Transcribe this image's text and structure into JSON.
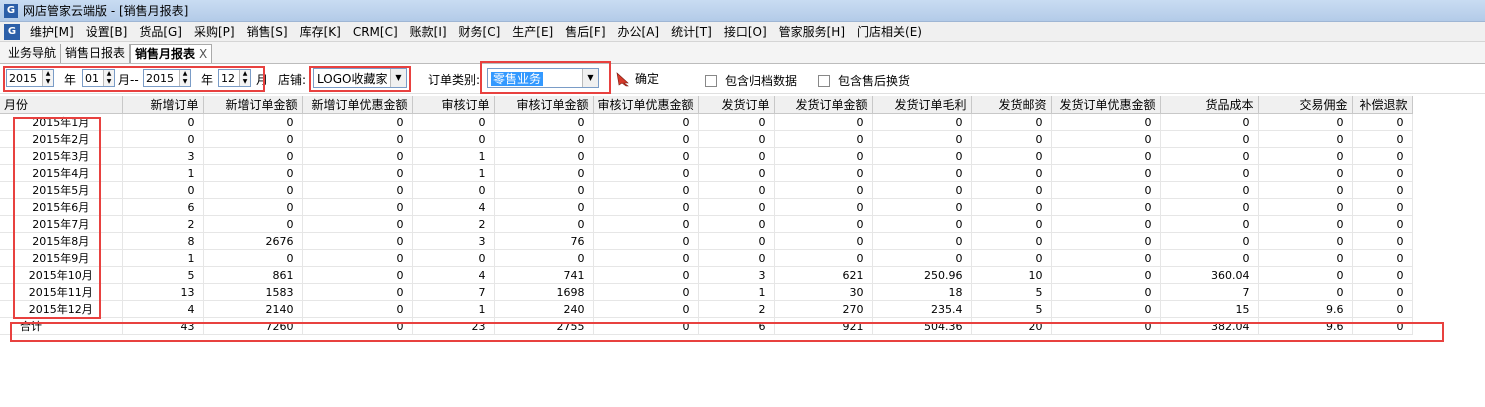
{
  "window": {
    "title": "网店管家云端版 - [销售月报表]"
  },
  "menu": [
    "维护[M]",
    "设置[B]",
    "货品[G]",
    "采购[P]",
    "销售[S]",
    "库存[K]",
    "CRM[C]",
    "账款[I]",
    "财务[C]",
    "生产[E]",
    "售后[F]",
    "办公[A]",
    "统计[T]",
    "接口[O]",
    "管家服务[H]",
    "门店相关(E)"
  ],
  "tabs": [
    {
      "label": "业务导航"
    },
    {
      "label": "销售日报表"
    },
    {
      "label": "销售月报表",
      "close": "X"
    }
  ],
  "filter": {
    "from_year": "2015",
    "year_label1": "年",
    "from_month": "01",
    "month_sep": "月--",
    "to_year": "2015",
    "year_label2": "年",
    "to_month": "12",
    "month_label": "月",
    "shop_label": "店铺:",
    "shop_value": "LOGO收藏家",
    "order_type_label": "订单类别:",
    "order_type_value": "零售业务",
    "confirm_label": "确定",
    "archive_label": "包含归档数据",
    "aftersale_label": "包含售后换货"
  },
  "table": {
    "columns": [
      "月份",
      "新增订单",
      "新增订单金额",
      "新增订单优惠金额",
      "审核订单",
      "审核订单金额",
      "审核订单优惠金额",
      "发货订单",
      "发货订单金额",
      "发货订单毛利",
      "发货邮资",
      "发货订单优惠金额",
      "货品成本",
      "交易佣金",
      "补偿退款"
    ],
    "rows": [
      [
        "2015年1月",
        "0",
        "0",
        "0",
        "0",
        "0",
        "0",
        "0",
        "0",
        "0",
        "0",
        "0",
        "0",
        "0",
        "0"
      ],
      [
        "2015年2月",
        "0",
        "0",
        "0",
        "0",
        "0",
        "0",
        "0",
        "0",
        "0",
        "0",
        "0",
        "0",
        "0",
        "0"
      ],
      [
        "2015年3月",
        "3",
        "0",
        "0",
        "1",
        "0",
        "0",
        "0",
        "0",
        "0",
        "0",
        "0",
        "0",
        "0",
        "0"
      ],
      [
        "2015年4月",
        "1",
        "0",
        "0",
        "1",
        "0",
        "0",
        "0",
        "0",
        "0",
        "0",
        "0",
        "0",
        "0",
        "0"
      ],
      [
        "2015年5月",
        "0",
        "0",
        "0",
        "0",
        "0",
        "0",
        "0",
        "0",
        "0",
        "0",
        "0",
        "0",
        "0",
        "0"
      ],
      [
        "2015年6月",
        "6",
        "0",
        "0",
        "4",
        "0",
        "0",
        "0",
        "0",
        "0",
        "0",
        "0",
        "0",
        "0",
        "0"
      ],
      [
        "2015年7月",
        "2",
        "0",
        "0",
        "2",
        "0",
        "0",
        "0",
        "0",
        "0",
        "0",
        "0",
        "0",
        "0",
        "0"
      ],
      [
        "2015年8月",
        "8",
        "2676",
        "0",
        "3",
        "76",
        "0",
        "0",
        "0",
        "0",
        "0",
        "0",
        "0",
        "0",
        "0"
      ],
      [
        "2015年9月",
        "1",
        "0",
        "0",
        "0",
        "0",
        "0",
        "0",
        "0",
        "0",
        "0",
        "0",
        "0",
        "0",
        "0"
      ],
      [
        "2015年10月",
        "5",
        "861",
        "0",
        "4",
        "741",
        "0",
        "3",
        "621",
        "250.96",
        "10",
        "0",
        "360.04",
        "0",
        "0"
      ],
      [
        "2015年11月",
        "13",
        "1583",
        "0",
        "7",
        "1698",
        "0",
        "1",
        "30",
        "18",
        "5",
        "0",
        "7",
        "0",
        "0"
      ],
      [
        "2015年12月",
        "4",
        "2140",
        "0",
        "1",
        "240",
        "0",
        "2",
        "270",
        "235.4",
        "5",
        "0",
        "15",
        "9.6",
        "0"
      ]
    ],
    "total": [
      "合计",
      "43",
      "7260",
      "0",
      "23",
      "2755",
      "0",
      "6",
      "921",
      "504.36",
      "20",
      "0",
      "382.04",
      "9.6",
      "0"
    ]
  },
  "colors": {
    "highlight": "#e8413f",
    "selection": "#3399ff"
  }
}
